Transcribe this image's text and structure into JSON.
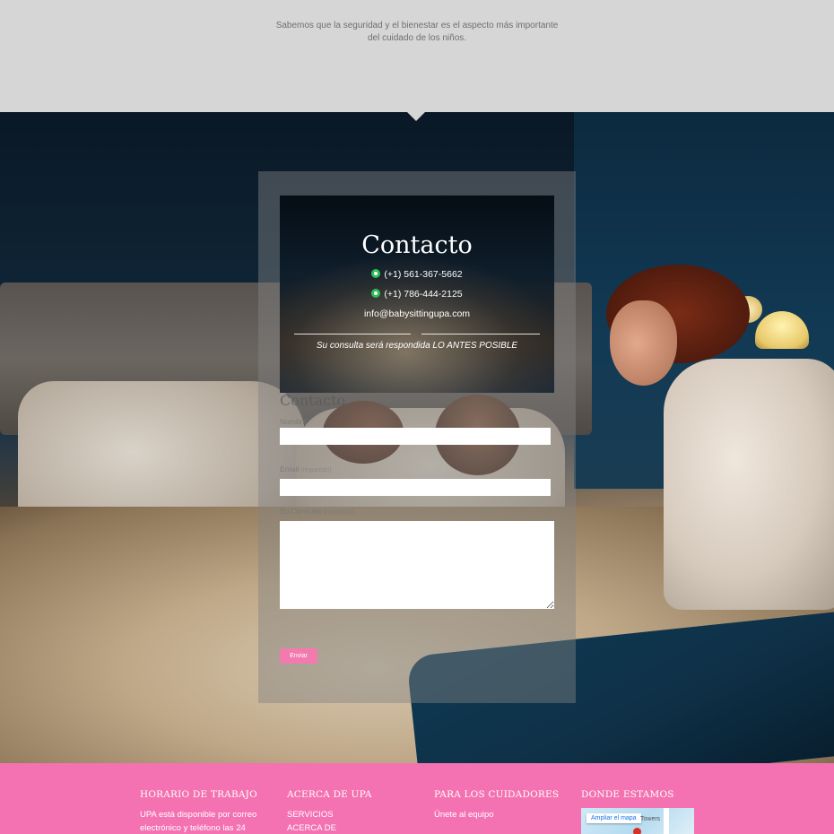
{
  "intro": {
    "line1": "Sabemos que la seguridad y el bienestar es el aspecto más importante",
    "line2": "del cuidado de los niños."
  },
  "contact_card": {
    "title": "Contacto",
    "phone1": "(+1) 561-367-5662",
    "phone2": "(+1) 786-444-2125",
    "email": "info@babysittingupa.com",
    "note": "Su consulta será respondida LO ANTES POSIBLE",
    "phone_icon": "whatsapp-icon"
  },
  "form": {
    "title": "Contacto",
    "name_label": "Nombre",
    "email_label": "Email",
    "email_required": "(requerido)",
    "message_label": "Su Consulta",
    "message_required": "(requerido)",
    "submit_label": "Enviar"
  },
  "footer": {
    "background_color": "#f472b2",
    "columns": [
      {
        "title": "HORARIO DE TRABAJO",
        "text1": "UPA está disponible por correo",
        "text2": "electrónico y teléfono las 24"
      },
      {
        "title": "ACERCA DE UPA",
        "text1": "SERVICIOS",
        "text2": "ACERCA DE"
      },
      {
        "title": "PARA LOS CUIDADORES",
        "text1": "Únete al equipo"
      },
      {
        "title": "DONDE ESTAMOS"
      }
    ],
    "map": {
      "button_label": "Ampliar el mapa",
      "label": "Towers"
    }
  },
  "colors": {
    "accent_pink": "#f472b2",
    "button_pink": "#f27aaf",
    "top_band": "#d6d6d6"
  }
}
